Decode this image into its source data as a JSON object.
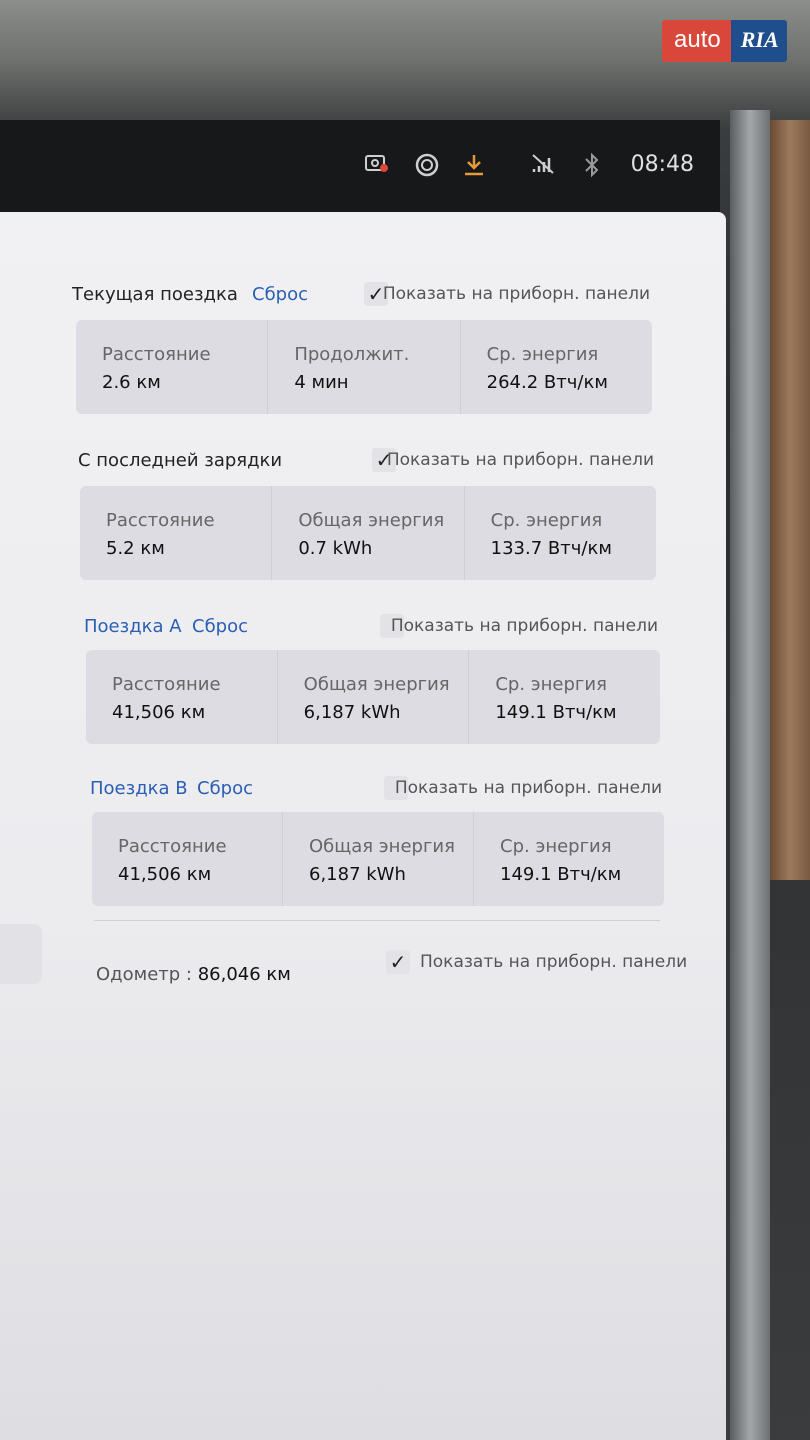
{
  "watermark": {
    "left": "auto",
    "right": "RIA"
  },
  "status": {
    "time": "08:48",
    "icons": [
      "camera-record-icon",
      "circle-icon",
      "download-icon",
      "no-signal-icon",
      "bluetooth-icon"
    ]
  },
  "current_trip": {
    "title": "Текущая поездка",
    "reset": "Сброс",
    "show_label": "Показать на приборн. панели",
    "checked": true,
    "cells": [
      {
        "label": "Расстояние",
        "value": "2.6 км"
      },
      {
        "label": "Продолжит.",
        "value": "4 мин"
      },
      {
        "label": "Ср. энергия",
        "value": "264.2 Втч/км"
      }
    ]
  },
  "since_charge": {
    "title": "С последней зарядки",
    "show_label": "Показать на приборн. панели",
    "checked": true,
    "cells": [
      {
        "label": "Расстояние",
        "value": "5.2 км"
      },
      {
        "label": "Общая энергия",
        "value": "0.7 kWh"
      },
      {
        "label": "Ср. энергия",
        "value": "133.7 Втч/км"
      }
    ]
  },
  "trip_a": {
    "title": "Поездка А",
    "reset": "Сброс",
    "show_label": "Показать на приборн. панели",
    "checked": false,
    "cells": [
      {
        "label": "Расстояние",
        "value": "41,506 км"
      },
      {
        "label": "Общая энергия",
        "value": "6,187 kWh"
      },
      {
        "label": "Ср. энергия",
        "value": "149.1 Втч/км"
      }
    ]
  },
  "trip_b": {
    "title": "Поездка В",
    "reset": "Сброс",
    "show_label": "Показать на приборн. панели",
    "checked": false,
    "cells": [
      {
        "label": "Расстояние",
        "value": "41,506 км"
      },
      {
        "label": "Общая энергия",
        "value": "6,187 kWh"
      },
      {
        "label": "Ср. энергия",
        "value": "149.1 Втч/км"
      }
    ]
  },
  "odometer": {
    "label": "Одометр :",
    "value": "86,046 км",
    "show_label": "Показать на приборн. панели",
    "checked": true
  }
}
